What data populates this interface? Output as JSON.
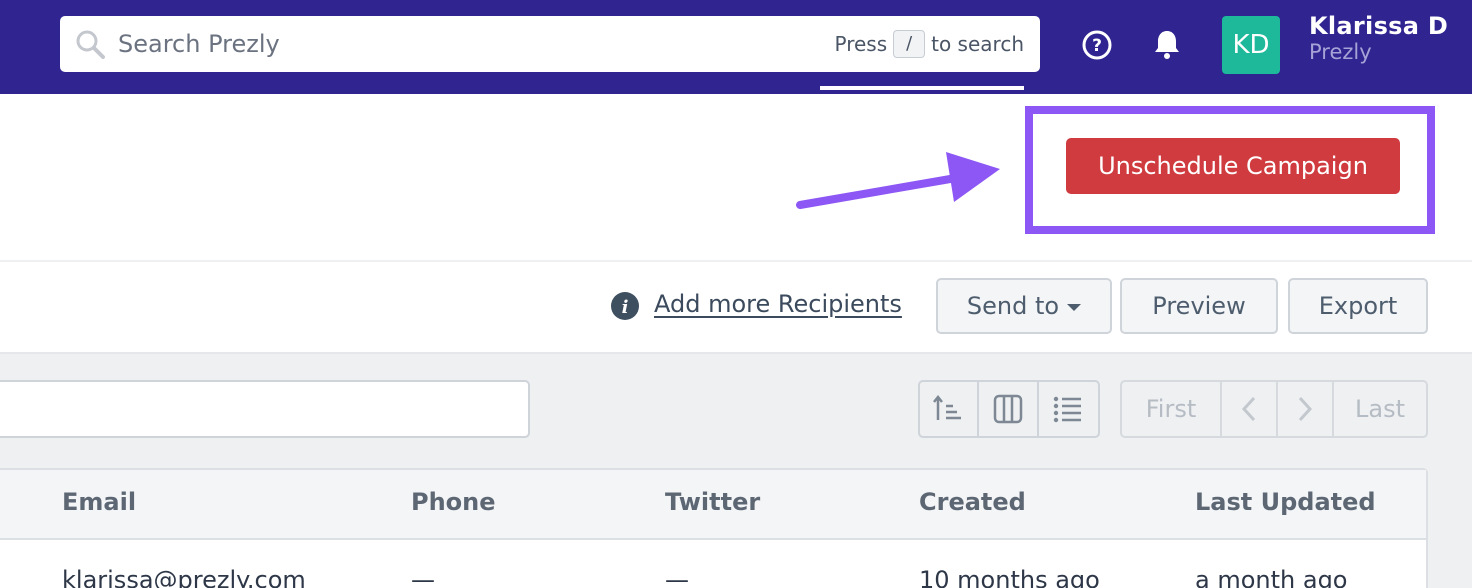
{
  "topbar": {
    "search_placeholder": "Search Prezly",
    "hint_prefix": "Press",
    "hint_key": "/",
    "hint_suffix": "to search",
    "help_icon": "question-circle-icon",
    "bell_icon": "bell-icon",
    "avatar_initials": "KD",
    "user_name": "Klarissa D",
    "user_org": "Prezly",
    "bg_color": "#2f2490",
    "avatar_color": "#1db99a"
  },
  "campaign": {
    "unschedule_label": "Unschedule Campaign",
    "button_color": "#cf3b3f",
    "highlight_color": "#8d57f5"
  },
  "actions": {
    "add_recipients_label": "Add more Recipients",
    "send_to_label": "Send to",
    "preview_label": "Preview",
    "export_label": "Export"
  },
  "pagination": {
    "first_label": "First",
    "prev_icon": "chevron-left-icon",
    "next_icon": "chevron-right-icon",
    "last_label": "Last"
  },
  "view_controls": [
    "sort-icon",
    "columns-icon",
    "list-icon"
  ],
  "table": {
    "columns": [
      "Email",
      "Phone",
      "Twitter",
      "Created",
      "Last Updated"
    ],
    "rows": [
      [
        "klarissa@prezly.com",
        "—",
        "—",
        "10 months ago",
        "a month ago"
      ]
    ]
  }
}
